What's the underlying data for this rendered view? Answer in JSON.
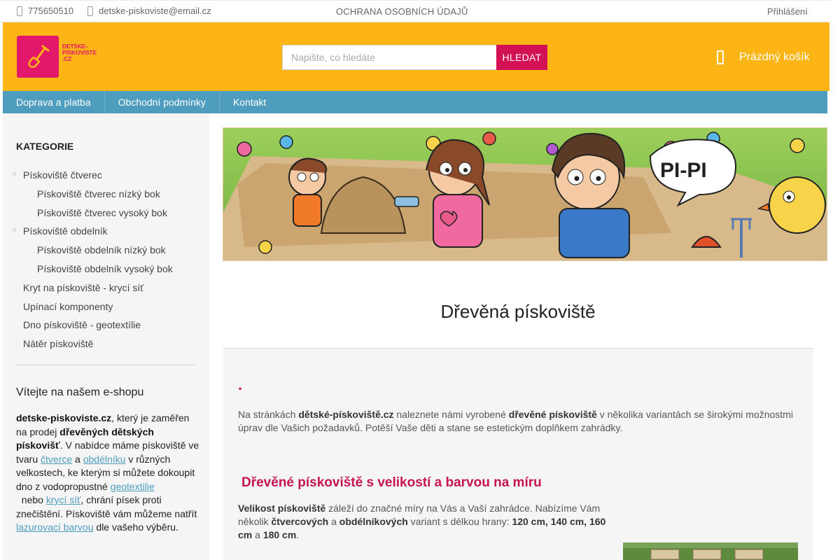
{
  "topbar": {
    "phone": "775650510",
    "email": "detske-piskoviste@email.cz",
    "privacy": "OCHRANA OSOBNÍCH ÚDAJŮ",
    "login": "Přihlášení"
  },
  "header": {
    "logo_text": "DETSKE-PISKOVISTE.CZ",
    "search_placeholder": "Napište, co hledáte",
    "search_button": "HLEDAT",
    "cart_label": "Prázdný košík"
  },
  "nav": {
    "items": [
      "Doprava a platba",
      "Obchodní podmínky",
      "Kontakt"
    ]
  },
  "sidebar": {
    "title": "KATEGORIE",
    "categories": [
      {
        "label": "Pískoviště čtverec",
        "level": 0,
        "bullet": true
      },
      {
        "label": "Pískoviště čtverec nízký bok",
        "level": 1
      },
      {
        "label": "Pískoviště čtverec vysoký bok",
        "level": 1
      },
      {
        "label": "Pískoviště obdelník",
        "level": 0,
        "bullet": true
      },
      {
        "label": "Pískoviště obdelník nízký bok",
        "level": 1
      },
      {
        "label": "Pískoviště obdelník vysoký bok",
        "level": 1
      },
      {
        "label": "Kryt na pískoviště - krycí síť",
        "level": 0
      },
      {
        "label": "Upínací komponenty",
        "level": 0
      },
      {
        "label": "Dno pískoviště - geotextílie",
        "level": 0
      },
      {
        "label": "Nátěr pískoviště",
        "level": 0
      }
    ],
    "welcome_title": "Vítejte na našem e-shopu",
    "welcome": {
      "brand": "detske-piskoviste.cz",
      "t1": ", který je zaměřen na prodej ",
      "b1": "dřevěných dětských pískovišť",
      "t2": ". V nabídce máme pískoviště ve tvaru ",
      "l1": "čtverce",
      "t3": " a ",
      "l2": "obdélníku",
      "t4": " v různých velkostech, ke kterým si můžete dokoupit dno z vodopropustné ",
      "l3": "geotextilie",
      "t5": "  nebo ",
      "l4": "krycí síť",
      "t6": ", chrání písek proti znečištění. Pískoviště vám můžeme natřít ",
      "l5": "lazurovací barvou",
      "t7": " dle vašeho výběru."
    }
  },
  "banner": {
    "speech": "PI-PI"
  },
  "main": {
    "title": "Dřevěná pískoviště",
    "dot": ".",
    "intro": {
      "t1": "Na stránkách ",
      "b1": "dětské-pískoviště.cz",
      "t2": " naleznete námi vyrobené ",
      "b2": "dřevěné pískoviště",
      "t3": " v několika variantách se širokými možnostmi úprav dle Vašich požadavků. Potěší Vaše děti a stane se estetickým doplňkem zahrádky."
    },
    "subhead": "Dřevěné pískoviště s velikostí a barvou na míru",
    "para2": {
      "b1": "Velikost pískoviště",
      "t1": " záleží do značné míry na Vás a Vaší zahrádce. Nabízíme Vám několik ",
      "b2": "čtvercových",
      "t2": " a ",
      "b3": "obdélníkových",
      "t3": " variant s délkou hrany: ",
      "b4": "120 cm, 140 cm, 160 cm",
      "t4": " a ",
      "b5": "180 cm",
      "t5": "."
    }
  }
}
